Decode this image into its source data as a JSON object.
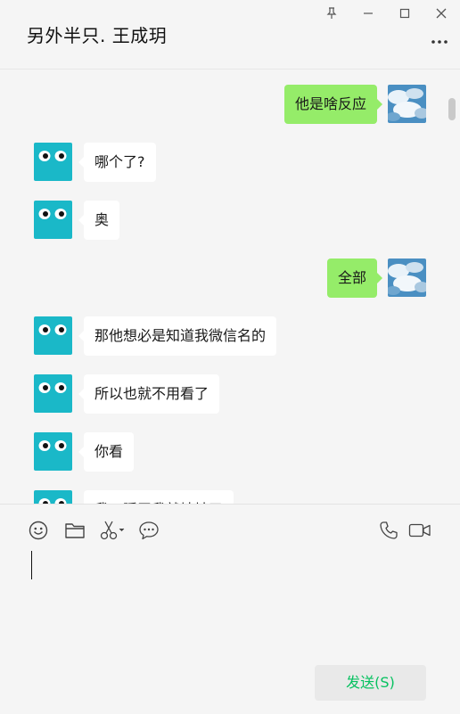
{
  "window": {
    "title": "另外半只. 王成玥"
  },
  "colors": {
    "background": "#f5f5f5",
    "incoming_bubble": "#ffffff",
    "outgoing_bubble": "#95ec69",
    "send_text": "#07c160",
    "avatar_teal": "#1ab8c8"
  },
  "window_controls": [
    "pin-icon",
    "minimize-icon",
    "maximize-icon",
    "close-icon",
    "more-icon"
  ],
  "messages": [
    {
      "side": "out",
      "text": "他是啥反应"
    },
    {
      "side": "in",
      "text": "哪个了?"
    },
    {
      "side": "in",
      "text": "奥"
    },
    {
      "side": "out",
      "text": "全部"
    },
    {
      "side": "in",
      "text": "那他想必是知道我微信名的"
    },
    {
      "side": "in",
      "text": "所以也就不用看了"
    },
    {
      "side": "in",
      "text": "你看"
    },
    {
      "side": "in",
      "text": "我一瞬无我就地址了"
    }
  ],
  "toolbar": {
    "icons": [
      "emoji-icon",
      "folder-icon",
      "scissors-icon",
      "chat-bubble-icon",
      "phone-icon",
      "video-icon"
    ]
  },
  "composer": {
    "value": "",
    "send_label": "发送(S)"
  }
}
